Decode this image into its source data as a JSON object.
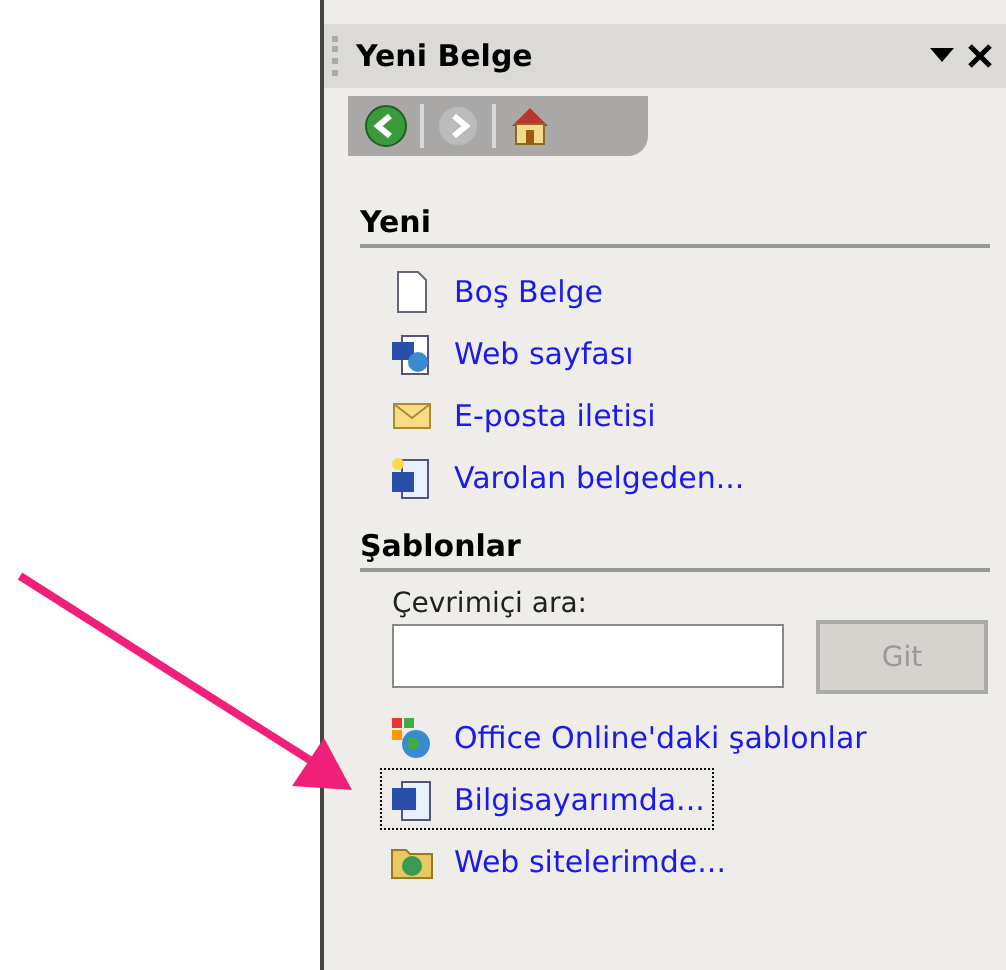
{
  "pane": {
    "title": "Yeni Belge",
    "nav": [
      {
        "kind": "back",
        "disabled": false
      },
      {
        "kind": "forward",
        "disabled": true
      },
      {
        "kind": "home",
        "disabled": false
      }
    ],
    "sections": [
      {
        "heading": "Yeni",
        "items": [
          {
            "kind": "blank",
            "label": "Boş Belge",
            "focused": false
          },
          {
            "kind": "web",
            "label": "Web sayfası",
            "focused": false
          },
          {
            "kind": "mail",
            "label": "E-posta iletisi",
            "focused": false
          },
          {
            "kind": "existing",
            "label": "Varolan belgeden...",
            "focused": false
          }
        ]
      },
      {
        "heading": "Şablonlar",
        "search": {
          "label": "Çevrimiçi ara:",
          "button": "Git"
        },
        "items": [
          {
            "kind": "online",
            "label": "Office Online'daki şablonlar",
            "focused": false
          },
          {
            "kind": "computer",
            "label": "Bilgisayarımda...",
            "focused": true
          },
          {
            "kind": "websites",
            "label": "Web sitelerimde...",
            "focused": false
          }
        ]
      }
    ]
  }
}
